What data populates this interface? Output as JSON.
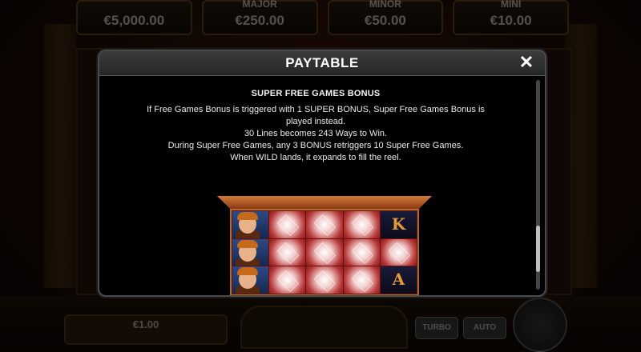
{
  "jackpots": [
    {
      "name": "",
      "value": "€5,000.00"
    },
    {
      "name": "MAJOR",
      "value": "€250.00"
    },
    {
      "name": "MINOR",
      "value": "€50.00"
    },
    {
      "name": "MINI",
      "value": "€10.00"
    }
  ],
  "modal": {
    "title": "PAYTABLE",
    "close_icon": "close-icon",
    "section_title": "SUPER FREE GAMES BONUS",
    "lines": [
      "If Free Games Bonus is triggered with 1 SUPER BONUS, Super Free Games Bonus is",
      "played instead.",
      "30 Lines becomes 243 Ways to Win.",
      "During Super Free Games, any 3 BONUS retriggers 10 Super Free Games.",
      "When WILD lands, it expands to fill the reel."
    ],
    "reels": [
      [
        "hero",
        "hero",
        "hero"
      ],
      [
        "gem",
        "gem",
        "gem"
      ],
      [
        "gem",
        "gem",
        "gem"
      ],
      [
        "gem",
        "gem",
        "gem"
      ],
      [
        "K",
        "gem",
        "A"
      ]
    ]
  },
  "bottom": {
    "bet_value": "€1.00",
    "turbo_label": "TURBO",
    "auto_label": "AUTO"
  },
  "colors": {
    "modal_bg": "#000000",
    "header_bg": "#333333",
    "reel_bg": "#6a0d0d",
    "card_letter": "#e29a3a"
  }
}
